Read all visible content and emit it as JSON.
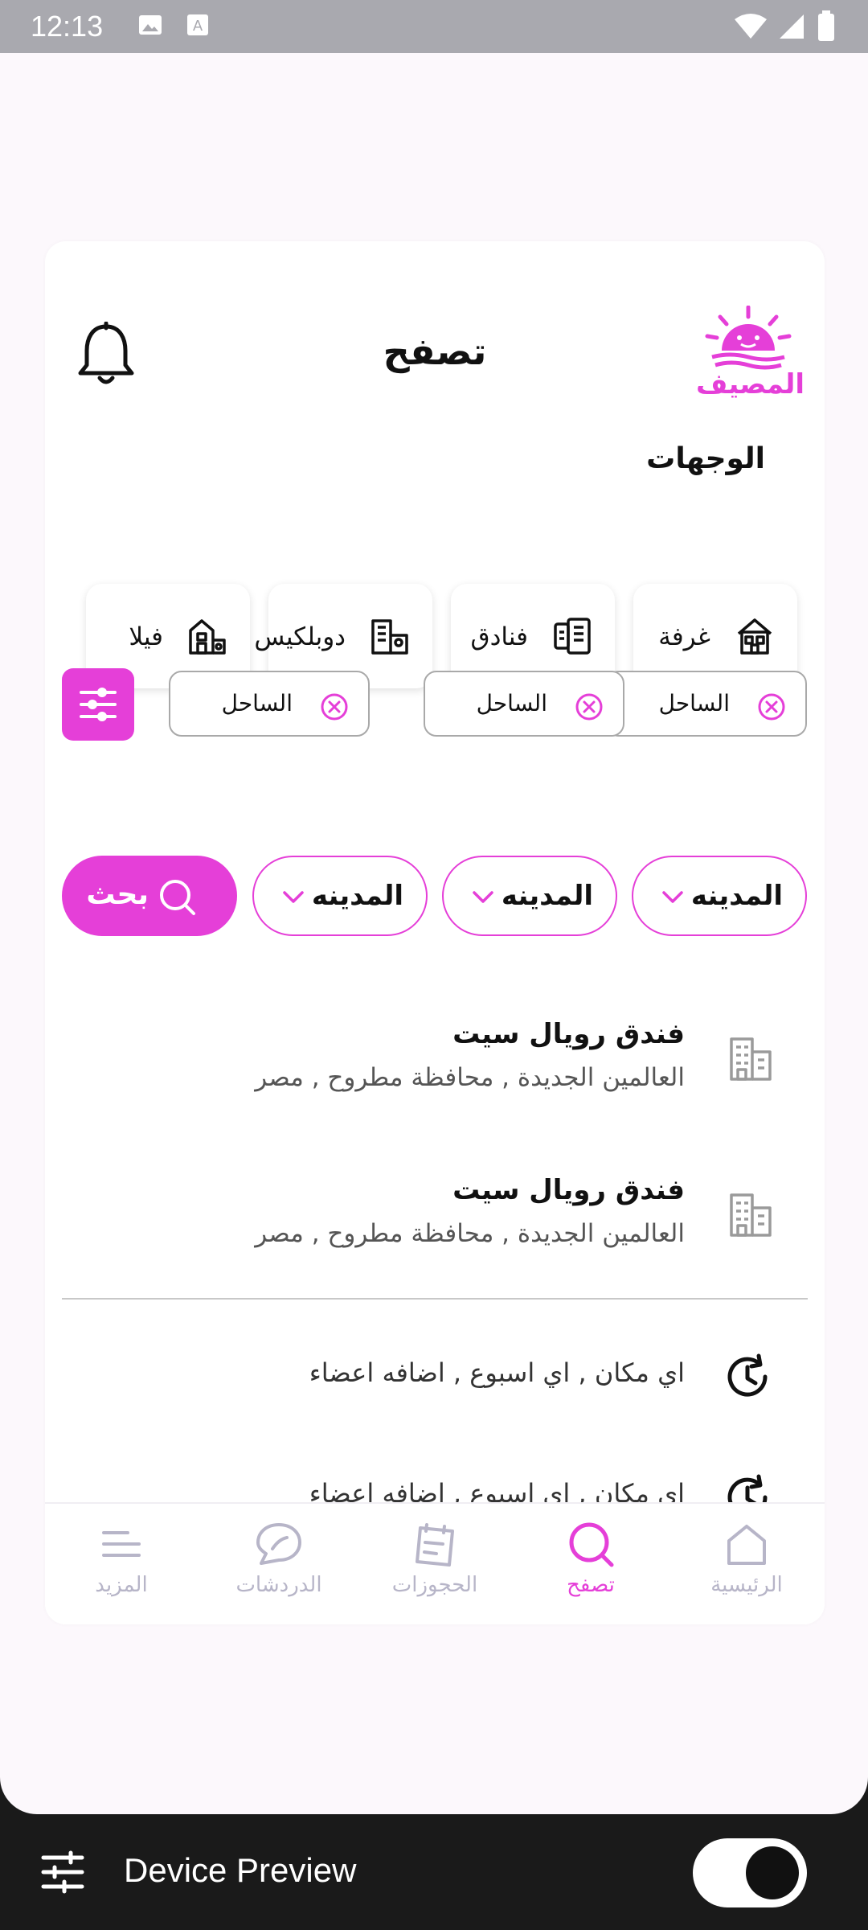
{
  "status_bar": {
    "time": "12:13",
    "icons": [
      "image-icon",
      "text-icon",
      "wifi-icon",
      "signal-icon",
      "battery-icon"
    ]
  },
  "header": {
    "logo_text": "المصيف",
    "title": "تصفح",
    "bell_icon": "bell-icon"
  },
  "destinations": {
    "title": "الوجهات",
    "items": [
      {
        "label": "غرفة",
        "icon": "house-icon"
      },
      {
        "label": "فنادق",
        "icon": "hotel-icon"
      },
      {
        "label": "دوبلكيس",
        "icon": "duplex-icon"
      },
      {
        "label": "فيلا",
        "icon": "villa-icon"
      }
    ]
  },
  "chips": [
    {
      "label": "الساحل"
    },
    {
      "label": "الساحل"
    },
    {
      "label": "الساحل"
    }
  ],
  "dropdowns": [
    {
      "label": "المدينه"
    },
    {
      "label": "المدينه"
    },
    {
      "label": "المدينه"
    }
  ],
  "search": {
    "label": "بحث"
  },
  "results": [
    {
      "title": "فندق رويال سيت",
      "subtitle": "العالمين الجديدة , محافظة مطروح , مصر"
    },
    {
      "title": "فندق رويال سيت",
      "subtitle": "العالمين الجديدة , محافظة مطروح , مصر"
    }
  ],
  "recent": [
    {
      "text": "اي مكان , اي اسبوع , اضافه اعضاء"
    },
    {
      "text": "اي مكان , اي اسبوع , اضافه اعضاء"
    }
  ],
  "nav": {
    "items": [
      {
        "label": "الرئيسية",
        "icon": "home-icon"
      },
      {
        "label": "تصفح",
        "icon": "search-icon",
        "active": true
      },
      {
        "label": "الحجوزات",
        "icon": "calendar-icon"
      },
      {
        "label": "الدردشات",
        "icon": "chat-icon"
      },
      {
        "label": "المزيد",
        "icon": "menu-icon"
      }
    ]
  },
  "device_preview": {
    "label": "Device Preview",
    "toggle_on": true
  },
  "colors": {
    "accent": "#e53fd8",
    "nav_inactive": "#b7b5c8",
    "status_bar": "#a9a9af"
  }
}
